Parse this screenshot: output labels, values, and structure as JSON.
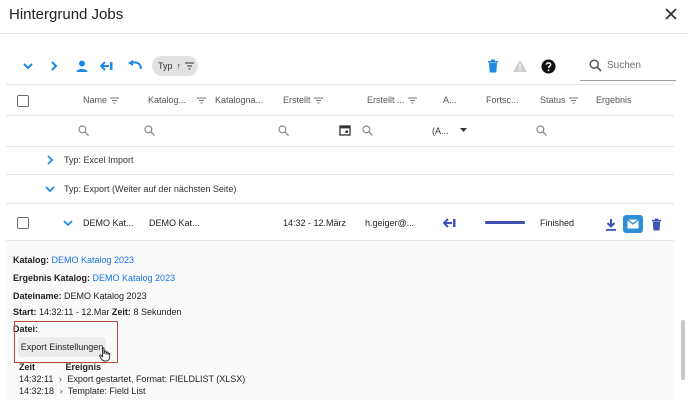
{
  "window": {
    "title": "Hintergrund Jobs"
  },
  "toolbar": {
    "sort_chip_label": "Typ",
    "sort_chip_arrow": "↑",
    "search_placeholder": "Suchen"
  },
  "columns": [
    {
      "key": "name",
      "label": "Name"
    },
    {
      "key": "katalog",
      "label": "Katalog..."
    },
    {
      "key": "katalogname",
      "label": "Katalogna..."
    },
    {
      "key": "erstellt",
      "label": "Erstellt"
    },
    {
      "key": "erstellt_von",
      "label": "Erstellt ..."
    },
    {
      "key": "art",
      "label": "A..."
    },
    {
      "key": "fortschritt",
      "label": "Fortsc..."
    },
    {
      "key": "status",
      "label": "Status"
    },
    {
      "key": "ergebnis",
      "label": "Ergebnis"
    }
  ],
  "filters": {
    "art_value": "(A..."
  },
  "groups": [
    {
      "label": "Typ: Excel Import",
      "expanded": false
    },
    {
      "label": "Typ: Export (Weiter auf der nächsten Seite)",
      "expanded": true
    }
  ],
  "row": {
    "name": "DEMO Kat...",
    "katalog": "DEMO Kat...",
    "erstellt": "14:32 - 12.März",
    "erstellt_von": "h.geiger@...",
    "progress": 1.0,
    "status": "Finished"
  },
  "detail": {
    "katalog_label": "Katalog:",
    "katalog_value": "DEMO Katalog 2023",
    "ergebnis_label": "Ergebnis Katalog:",
    "ergebnis_value": "DEMO Katalog 2023",
    "dateiname_label": "Dateiname:",
    "dateiname_value": "DEMO Katalog 2023",
    "start_label": "Start:",
    "start_value": "14:32:11 - 12.Mar",
    "zeit_label": "Zeit:",
    "zeit_value": "8 Sekunden",
    "datei_label": "Datei:",
    "export_button": "Export Einstellungen",
    "log_header_zeit": "Zeit",
    "log_header_ereignis": "Ereignis",
    "log": [
      {
        "time": "14:32:11",
        "event": "Export gestartet, Format: FIELDLIST (XLSX)"
      },
      {
        "time": "14:32:18",
        "event": "Template: Field List"
      }
    ]
  },
  "colors": {
    "accent": "#1e88e5",
    "primary_dark": "#3f51b5",
    "link": "#1a73e8",
    "highlight_border": "#b34b3b"
  },
  "icons": [
    "close-icon",
    "chevron-down-icon",
    "chevron-right-icon",
    "person-icon",
    "push-icon",
    "undo-icon",
    "sort-filter-icon",
    "delete-icon",
    "warning-icon",
    "help-icon",
    "search-icon",
    "calendar-icon",
    "download-icon",
    "mail-icon",
    "cursor-hand-icon"
  ]
}
